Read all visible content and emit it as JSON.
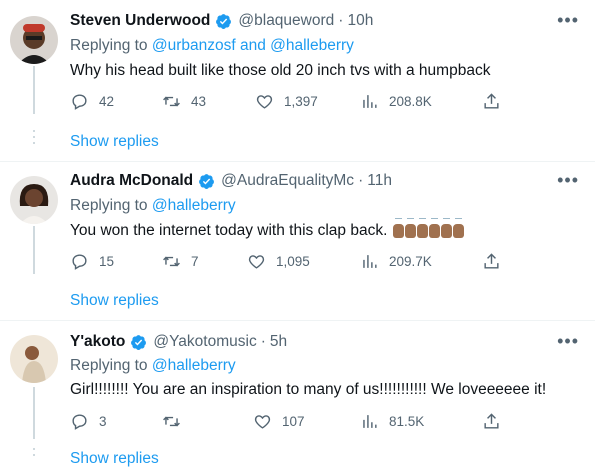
{
  "tweets": [
    {
      "name": "Steven Underwood",
      "handle": "@blaqueword",
      "time": "10h",
      "replying_prefix": "Replying to ",
      "mentions": "@urbanzosf and @halleberry",
      "text": "Why his head built like those old 20 inch tvs with a humpback",
      "replies": "42",
      "retweets": "43",
      "likes": "1,397",
      "views": "208.8K",
      "show_replies": "Show replies"
    },
    {
      "name": "Audra McDonald",
      "handle": "@AudraEqualityMc",
      "time": "11h",
      "replying_prefix": "Replying to ",
      "mentions": "@halleberry",
      "text": "You won the internet today with this clap back.",
      "replies": "15",
      "retweets": "7",
      "likes": "1,095",
      "views": "209.7K",
      "show_replies": "Show replies"
    },
    {
      "name": "Y'akoto",
      "handle": "@Yakotomusic",
      "time": "5h",
      "replying_prefix": "Replying to ",
      "mentions": "@halleberry",
      "text": "Girl!!!!!!!! You are an inspiration to many of us!!!!!!!!!!! We loveeeeee it!",
      "replies": "3",
      "retweets": "",
      "likes": "107",
      "views": "81.5K",
      "show_replies": "Show replies"
    }
  ],
  "separator": "·",
  "more_glyph": "•••",
  "icons": [
    "reply-icon",
    "retweet-icon",
    "like-icon",
    "views-icon",
    "share-icon",
    "verified-badge-icon",
    "more-icon"
  ],
  "colors": {
    "accent": "#1d9bf0",
    "muted": "#536471",
    "text": "#0f1419"
  }
}
